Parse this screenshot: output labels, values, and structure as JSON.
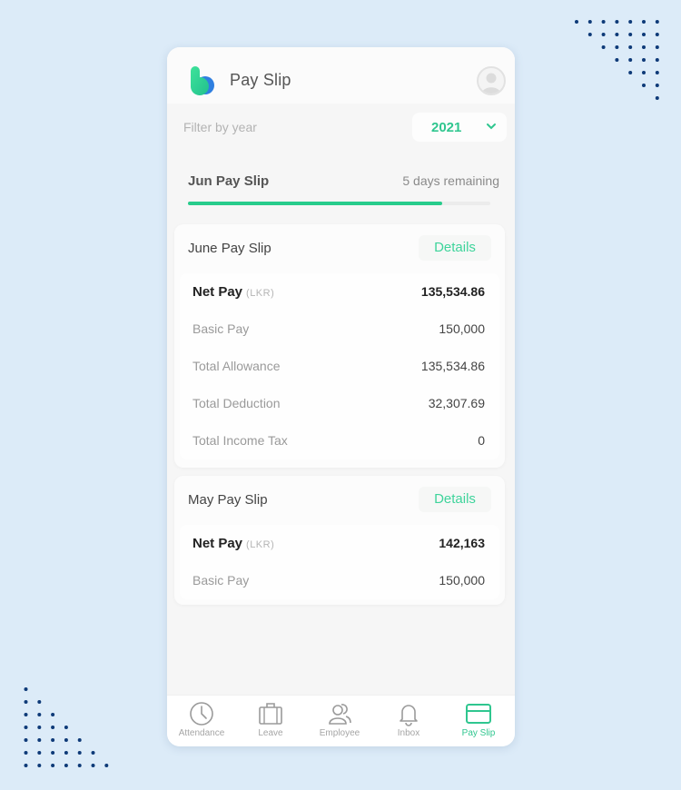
{
  "app": {
    "title": "Pay Slip",
    "logo_icon": "app-logo-b",
    "avatar_icon": "user-avatar-icon"
  },
  "filter": {
    "label": "Filter by year",
    "selected_year": "2021",
    "chevron_icon": "chevron-down-icon"
  },
  "current": {
    "title": "Jun Pay Slip",
    "remaining": "5 days remaining",
    "progress_percent": 84
  },
  "slips": [
    {
      "title": "June Pay Slip",
      "details_label": "Details",
      "rows": [
        {
          "label": "Net Pay",
          "unit": "(LKR)",
          "value": "135,534.86"
        },
        {
          "label": "Basic Pay",
          "value": "150,000"
        },
        {
          "label": "Total Allowance",
          "value": "135,534.86"
        },
        {
          "label": "Total Deduction",
          "value": "32,307.69"
        },
        {
          "label": "Total Income Tax",
          "value": "0"
        }
      ]
    },
    {
      "title": "May Pay Slip",
      "details_label": "Details",
      "rows": [
        {
          "label": "Net Pay",
          "unit": "(LKR)",
          "value": "142,163"
        },
        {
          "label": "Basic Pay",
          "value": "150,000"
        }
      ]
    }
  ],
  "nav": {
    "items": [
      {
        "label": "Attendance",
        "icon": "clock-icon"
      },
      {
        "label": "Leave",
        "icon": "briefcase-icon"
      },
      {
        "label": "Employee",
        "icon": "users-icon"
      },
      {
        "label": "Inbox",
        "icon": "bell-icon"
      },
      {
        "label": "Pay Slip",
        "icon": "credit-card-icon",
        "active": true
      }
    ]
  },
  "colors": {
    "accent": "#2fc68f",
    "background": "#dcebf8",
    "dots": "#0e3a78"
  }
}
